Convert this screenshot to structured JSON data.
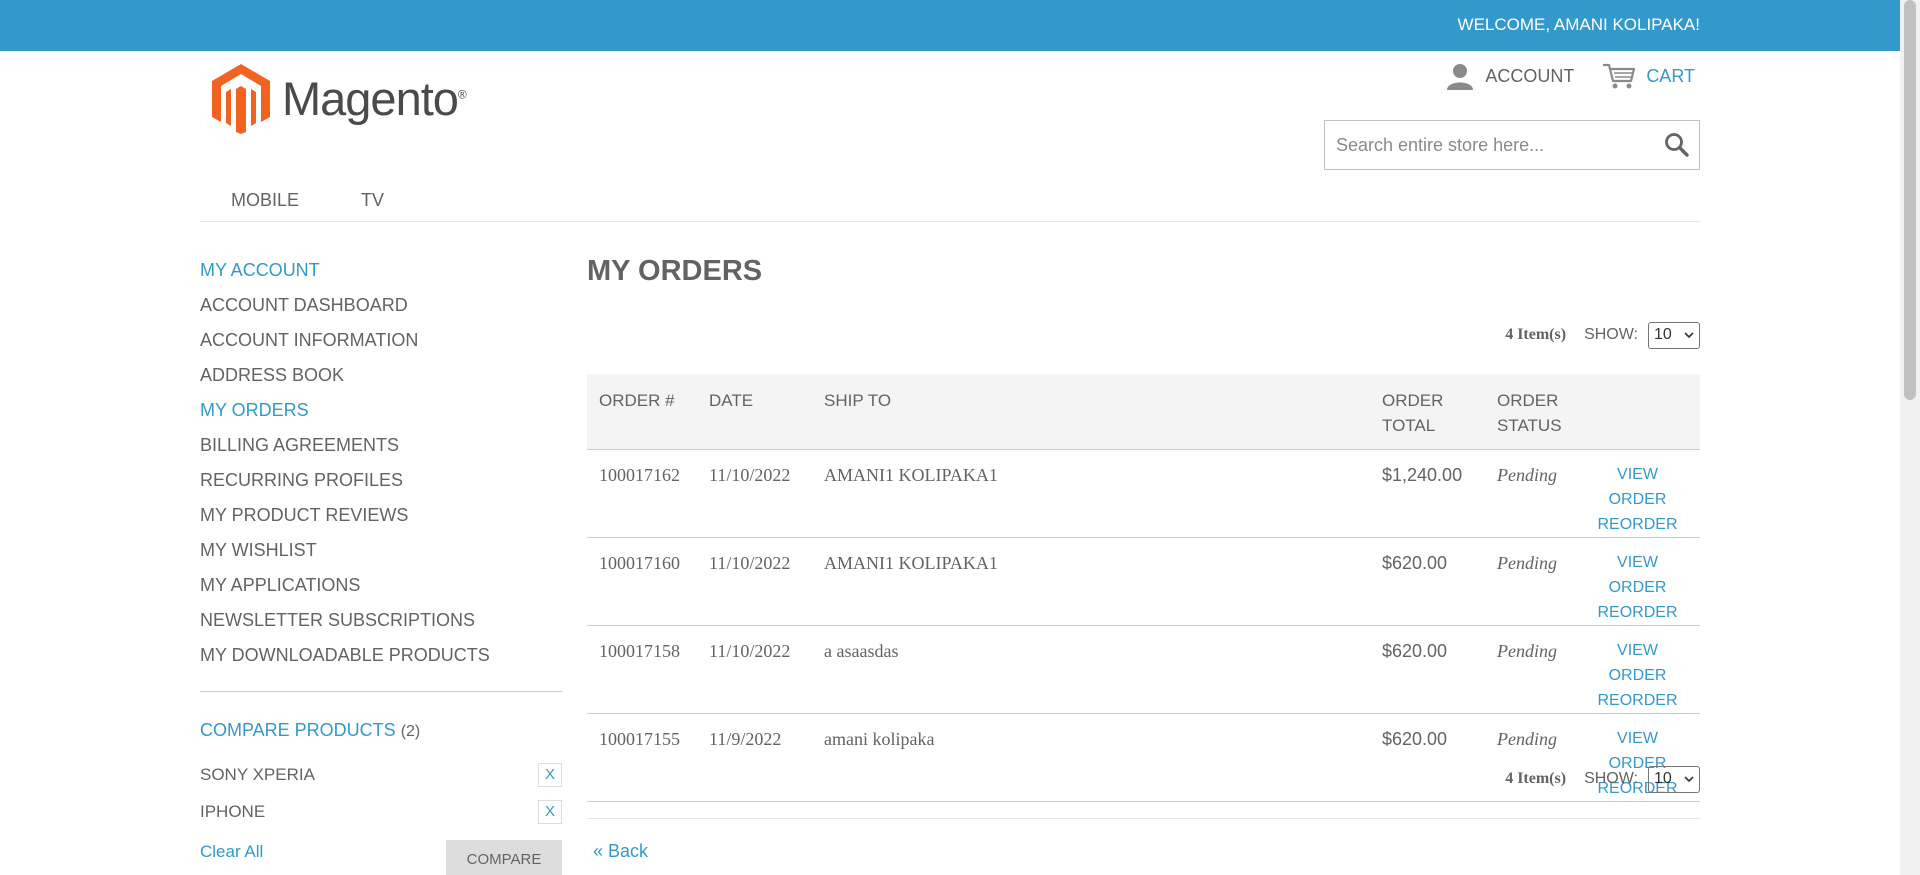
{
  "topbar": {
    "welcome": "WELCOME, AMANI KOLIPAKA!"
  },
  "brand": {
    "logo_text": "Magento",
    "reg": "®",
    "accent": "#f26322",
    "primary": "#3399cc"
  },
  "header": {
    "account_label": "ACCOUNT",
    "cart_label": "CART",
    "account_icon": "user-icon",
    "cart_icon": "cart-icon"
  },
  "search": {
    "placeholder": "Search entire store here...",
    "icon": "search-icon"
  },
  "nav": {
    "items": [
      "MOBILE",
      "TV"
    ]
  },
  "sidebar": {
    "title": "MY ACCOUNT",
    "items": [
      "ACCOUNT DASHBOARD",
      "ACCOUNT INFORMATION",
      "ADDRESS BOOK",
      "MY ORDERS",
      "BILLING AGREEMENTS",
      "RECURRING PROFILES",
      "MY PRODUCT REVIEWS",
      "MY WISHLIST",
      "MY APPLICATIONS",
      "NEWSLETTER SUBSCRIPTIONS",
      "MY DOWNLOADABLE PRODUCTS"
    ],
    "active": "MY ORDERS"
  },
  "compare": {
    "title": "COMPARE PRODUCTS",
    "count": "(2)",
    "items": [
      "SONY XPERIA",
      "IPHONE"
    ],
    "remove_label": "X",
    "clear_all": "Clear All",
    "compare_button": "COMPARE"
  },
  "main": {
    "title": "MY ORDERS",
    "item_count": "4 Item(s)",
    "show_label": "SHOW:",
    "show_value": "10",
    "columns": [
      "ORDER #",
      "DATE",
      "SHIP TO",
      "ORDER TOTAL",
      "ORDER STATUS"
    ],
    "orders": [
      {
        "id": "100017162",
        "date": "11/10/2022",
        "ship_to": "AMANI1 KOLIPAKA1",
        "total": "$1,240.00",
        "status": "Pending",
        "view": "VIEW ORDER",
        "reorder": "REORDER"
      },
      {
        "id": "100017160",
        "date": "11/10/2022",
        "ship_to": "AMANI1 KOLIPAKA1",
        "total": "$620.00",
        "status": "Pending",
        "view": "VIEW ORDER",
        "reorder": "REORDER"
      },
      {
        "id": "100017158",
        "date": "11/10/2022",
        "ship_to": "a asaasdas",
        "total": "$620.00",
        "status": "Pending",
        "view": "VIEW ORDER",
        "reorder": "REORDER"
      },
      {
        "id": "100017155",
        "date": "11/9/2022",
        "ship_to": "amani kolipaka",
        "total": "$620.00",
        "status": "Pending",
        "view": "VIEW ORDER",
        "reorder": "REORDER"
      }
    ],
    "back": "« Back"
  }
}
